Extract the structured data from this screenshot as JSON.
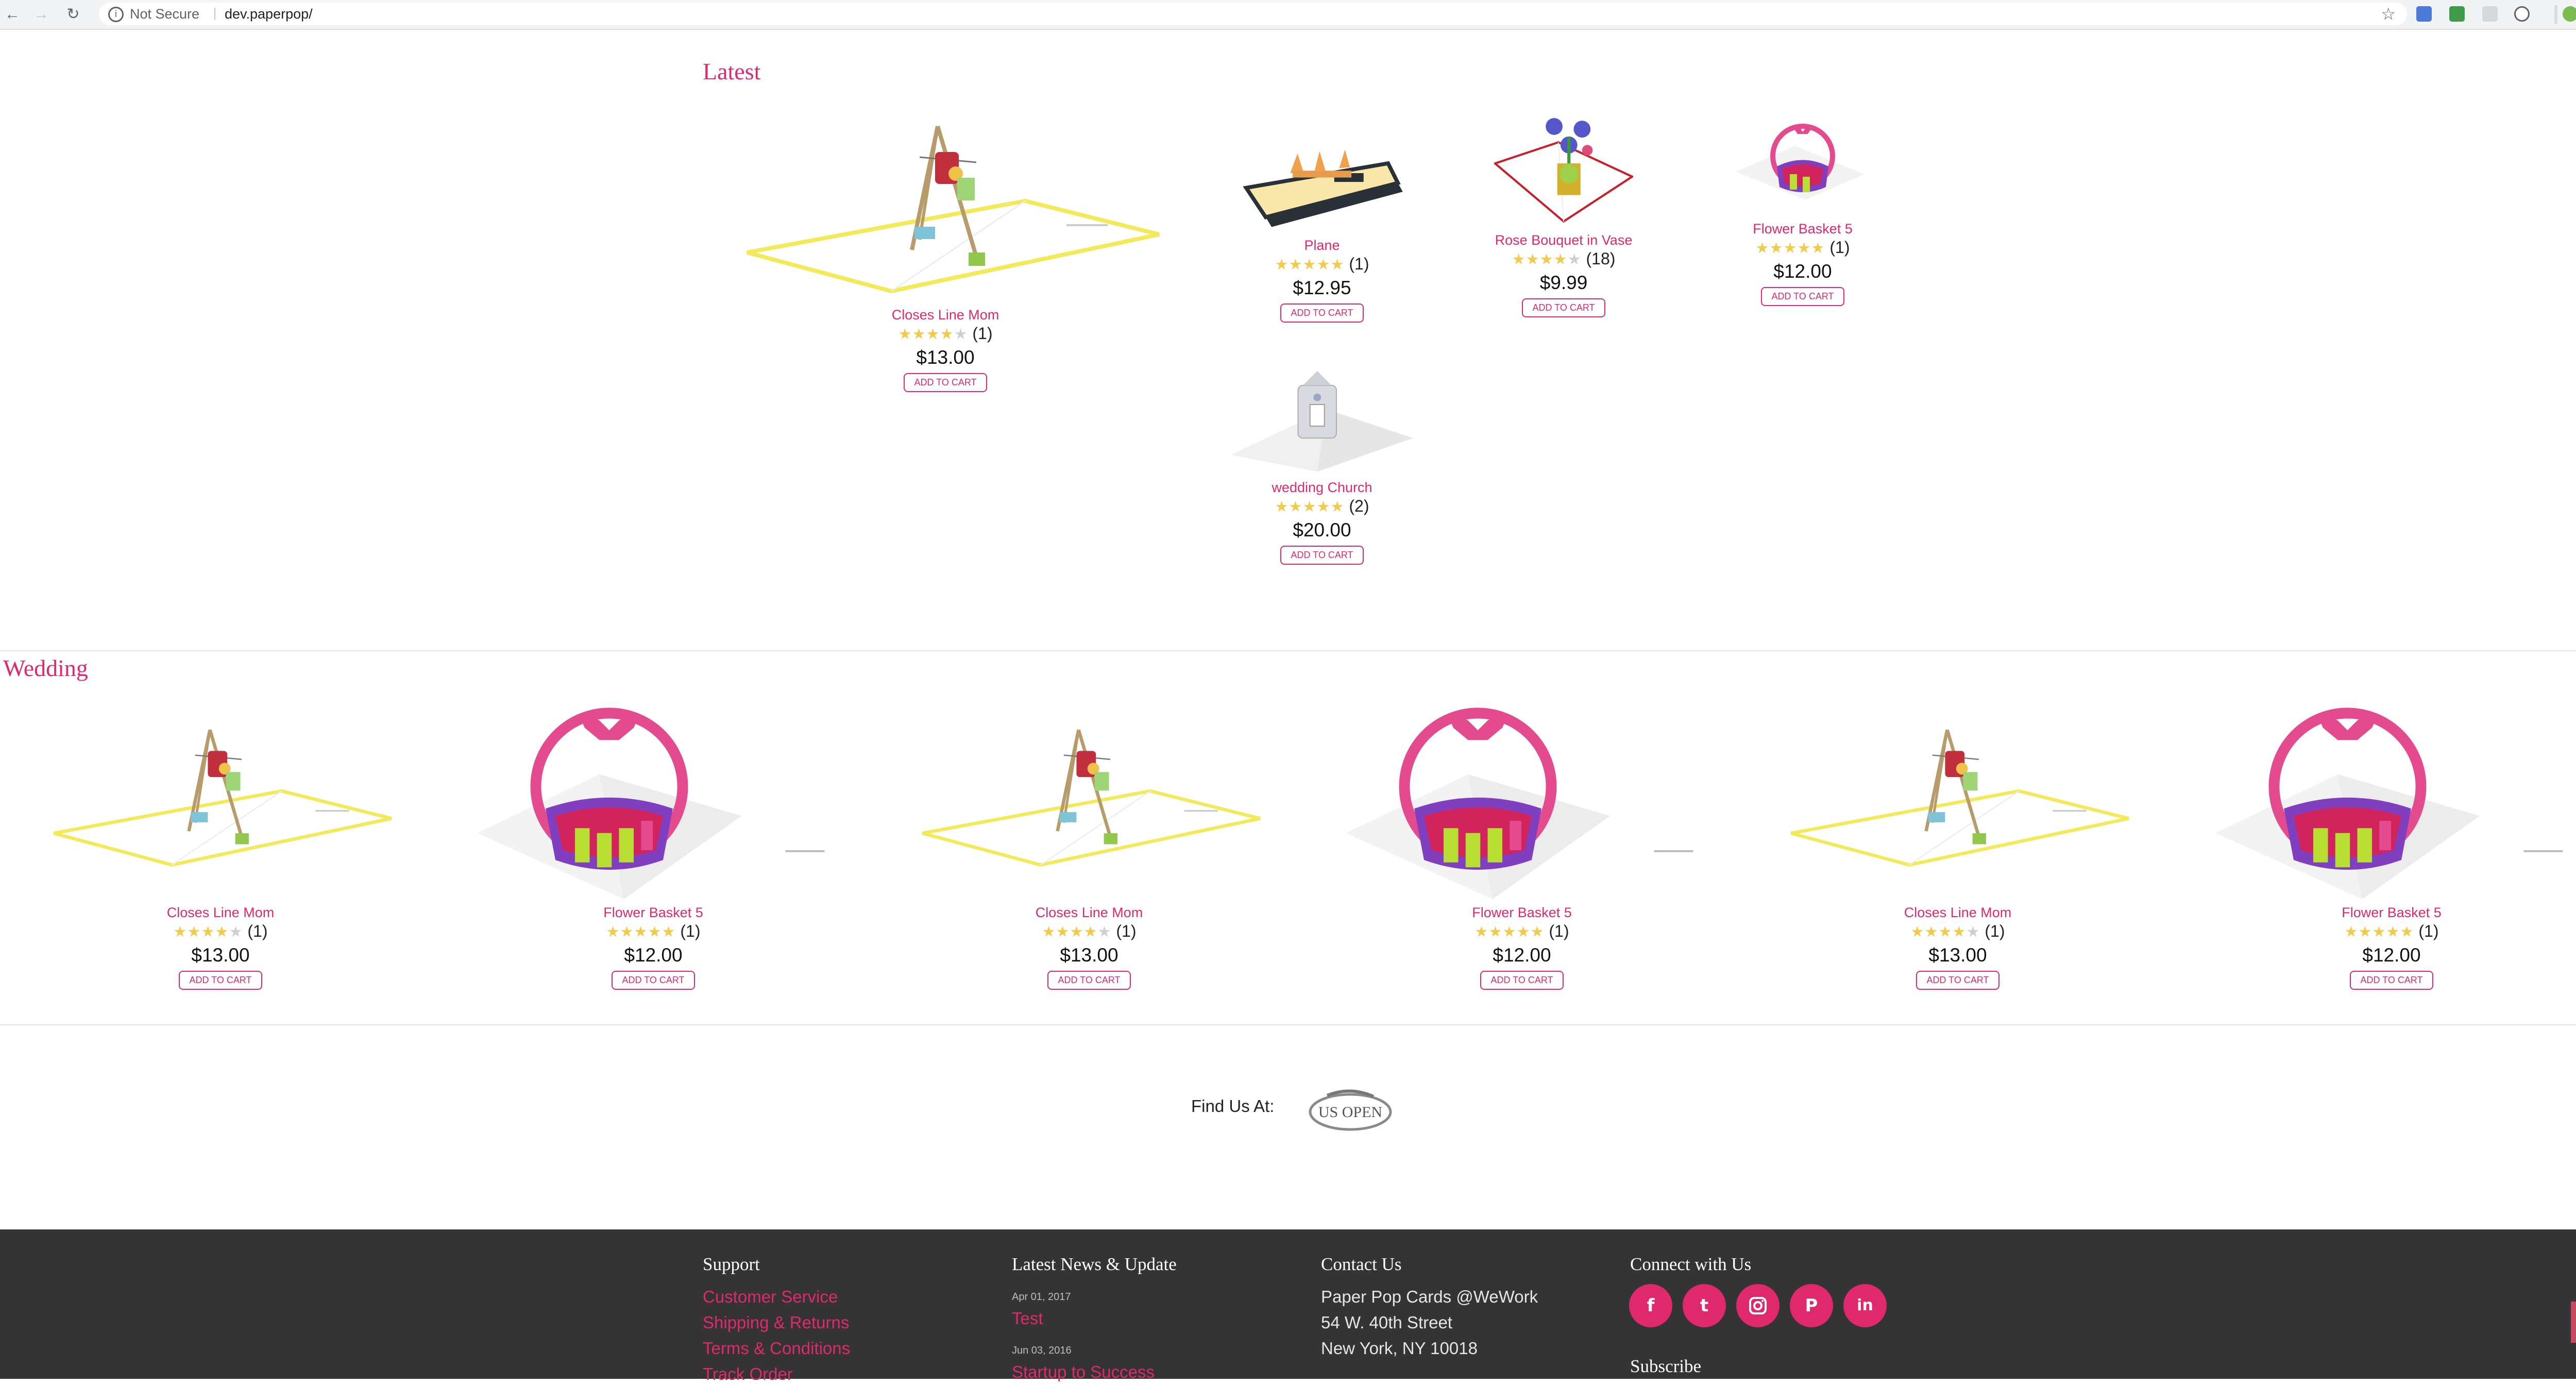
{
  "browser": {
    "security": "Not Secure",
    "url": "dev.paperpop/"
  },
  "sections": {
    "latest_title": "Latest",
    "wedding_title": "Wedding"
  },
  "latest": [
    {
      "name": "Closes Line Mom",
      "stars": 4,
      "count": "(1)",
      "price": "$13.00",
      "cart": "ADD TO CART"
    },
    {
      "name": "Plane",
      "stars": 5,
      "count": "(1)",
      "price": "$12.95",
      "cart": "ADD TO CART"
    },
    {
      "name": "Rose Bouquet in Vase",
      "stars": 4,
      "count": "(18)",
      "price": "$9.99",
      "cart": "ADD TO CART"
    },
    {
      "name": "Flower Basket 5",
      "stars": 5,
      "count": "(1)",
      "price": "$12.00",
      "cart": "ADD TO CART"
    },
    {
      "name": "wedding Church",
      "stars": 5,
      "count": "(2)",
      "price": "$20.00",
      "cart": "ADD TO CART"
    }
  ],
  "wedding": [
    {
      "name": "Closes Line Mom",
      "stars": 4,
      "count": "(1)",
      "price": "$13.00",
      "cart": "ADD TO CART"
    },
    {
      "name": "Flower Basket 5",
      "stars": 5,
      "count": "(1)",
      "price": "$12.00",
      "cart": "ADD TO CART"
    },
    {
      "name": "Closes Line Mom",
      "stars": 4,
      "count": "(1)",
      "price": "$13.00",
      "cart": "ADD TO CART"
    },
    {
      "name": "Flower Basket 5",
      "stars": 5,
      "count": "(1)",
      "price": "$12.00",
      "cart": "ADD TO CART"
    },
    {
      "name": "Closes Line Mom",
      "stars": 4,
      "count": "(1)",
      "price": "$13.00",
      "cart": "ADD TO CART"
    },
    {
      "name": "Flower Basket 5",
      "stars": 5,
      "count": "(1)",
      "price": "$12.00",
      "cart": "ADD TO CART"
    }
  ],
  "find_us": {
    "label": "Find Us At:",
    "partner_logo": "US OPEN"
  },
  "footer": {
    "support": {
      "title": "Support",
      "links": [
        "Customer Service",
        "Shipping & Returns",
        "Terms & Conditions",
        "Track Order"
      ]
    },
    "news": {
      "title": "Latest News & Update",
      "items": [
        {
          "date": "Apr 01, 2017",
          "title": "Test"
        },
        {
          "date": "Jun 03, 2016",
          "title": "Startup to Success"
        }
      ]
    },
    "contact": {
      "title": "Contact Us",
      "lines": [
        "Paper Pop Cards @WeWork",
        "54 W. 40th Street",
        "New York, NY 10018"
      ]
    },
    "connect": {
      "title": "Connect with Us",
      "subscribe": "Subscribe",
      "icons": [
        "facebook-icon",
        "twitter-icon",
        "instagram-icon",
        "pinterest-icon",
        "linkedin-icon"
      ]
    }
  },
  "colors": {
    "accent": "#e0286c",
    "footer_bg": "#343434",
    "star": "#f2cb4c"
  }
}
